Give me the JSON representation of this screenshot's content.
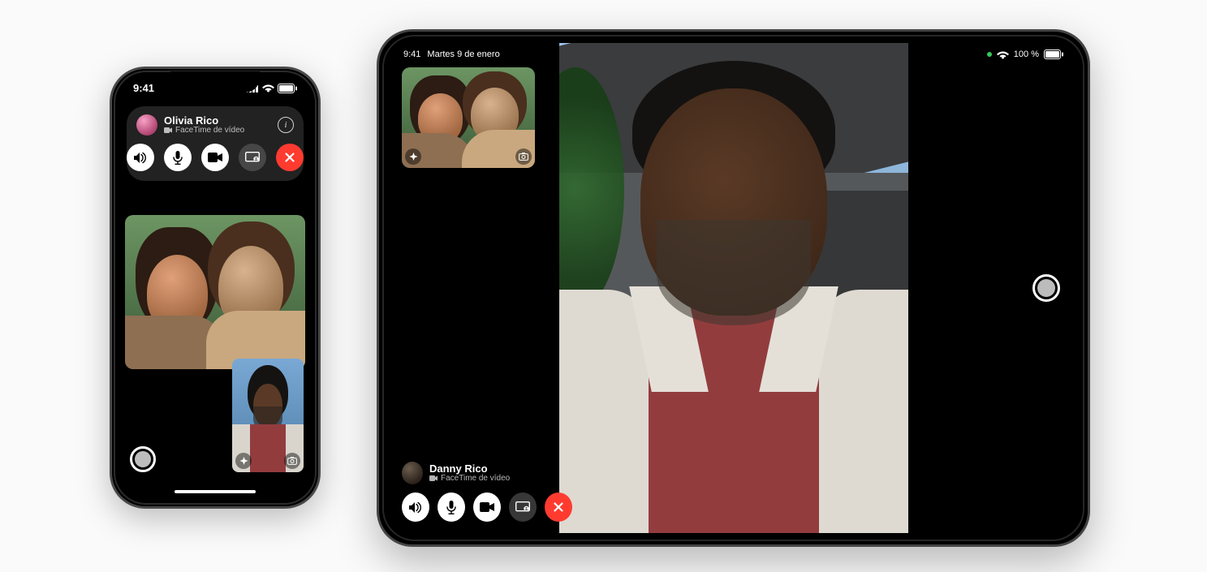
{
  "iphone": {
    "status": {
      "time": "9:41"
    },
    "caller": {
      "name": "Olivia Rico",
      "subtitle": "FaceTime de vídeo"
    },
    "controls": {
      "speaker": "speaker",
      "mic": "mic",
      "camera": "camera",
      "share": "share-screen",
      "end": "end-call"
    },
    "pip_badges": {
      "effects": "effects",
      "flip": "flip-camera"
    },
    "shutter": "live-photo-shutter"
  },
  "ipad": {
    "status": {
      "time": "9:41",
      "date": "Martes 9 de enero",
      "battery": "100 %"
    },
    "caller": {
      "name": "Danny Rico",
      "subtitle": "FaceTime de vídeo"
    },
    "controls": {
      "speaker": "speaker",
      "mic": "mic",
      "camera": "camera",
      "share": "share-screen",
      "end": "end-call"
    },
    "pip_badges": {
      "effects": "effects",
      "flip": "flip-camera"
    },
    "shutter": "live-photo-shutter"
  },
  "colors": {
    "end_call": "#ff3b30",
    "control_light": "#ffffff",
    "control_dark": "rgba(100,100,100,.55)"
  }
}
